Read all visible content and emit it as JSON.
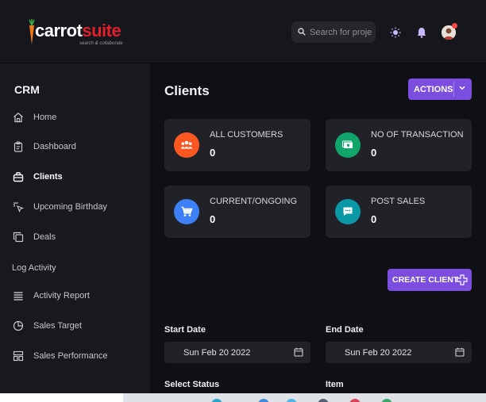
{
  "brand": {
    "name_part1": "carrot",
    "name_part2": "suite",
    "tagline": "search & collaborate"
  },
  "header": {
    "search_placeholder": "Search for projects"
  },
  "sidebar": {
    "title": "CRM",
    "items": [
      {
        "label": "Home",
        "icon": "home-icon"
      },
      {
        "label": "Dashboard",
        "icon": "clipboard-icon"
      },
      {
        "label": "Clients",
        "icon": "briefcase-icon",
        "active": true
      },
      {
        "label": "Upcoming Birthday",
        "icon": "sparkle-cursor-icon"
      },
      {
        "label": "Deals",
        "icon": "copy-icon"
      }
    ],
    "section_label": "Log Activity",
    "log_items": [
      {
        "label": "Activity Report",
        "icon": "list-icon"
      },
      {
        "label": "Sales Target",
        "icon": "pie-chart-icon"
      },
      {
        "label": "Sales Performance",
        "icon": "layout-icon"
      }
    ]
  },
  "main": {
    "title": "Clients",
    "actions_label": "ACTIONS",
    "cards": [
      {
        "label": "ALL CUSTOMERS",
        "value": "0",
        "color": "#ff5722",
        "icon": "users-icon"
      },
      {
        "label": "NO OF TRANSACTION",
        "value": "0",
        "color": "#10a56a",
        "icon": "money-icon"
      },
      {
        "label": "CURRENT/ONGOING",
        "value": "0",
        "color": "#3d7ff5",
        "icon": "cart-icon"
      },
      {
        "label": "POST SALES",
        "value": "0",
        "color": "#0b98a6",
        "icon": "chat-icon"
      }
    ],
    "create_label": "CREATE CLIENT",
    "start_date_label": "Start Date",
    "start_date_value": "Sun Feb 20 2022",
    "end_date_label": "End Date",
    "end_date_value": "Sun Feb 20 2022",
    "select_status_label": "Select Status",
    "item_label": "Item"
  },
  "colors": {
    "accent": "#7c4ee0",
    "background": "#0f1014",
    "sidebar": "#17191e",
    "card": "#202228"
  }
}
